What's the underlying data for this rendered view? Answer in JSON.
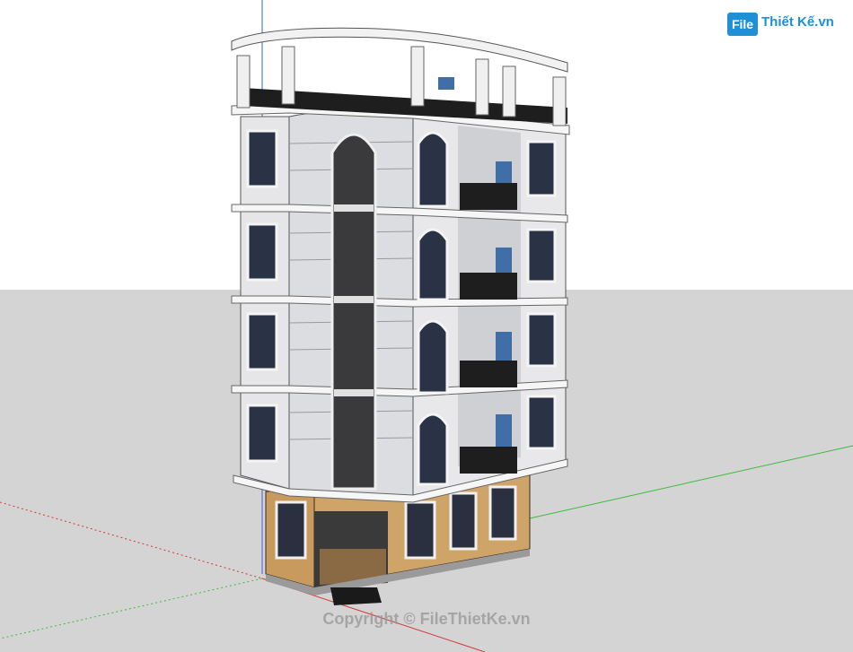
{
  "scene": {
    "description_colors": {
      "sky": "#ffffff",
      "ground": "#d6d6d6",
      "wall": "#e8e8ea",
      "trim": "#f4f4f4",
      "window_glass": "#2f3a4e",
      "railing": "#1e1e1e",
      "ground_floor_stone": "#caa066",
      "axis_green": "#3dbb3d",
      "axis_red": "#d23a3a",
      "axis_blue": "#3a5fd2"
    }
  },
  "logo": {
    "badge": "File",
    "text": "Thiết Kế.vn"
  },
  "watermark": "Copyright © FileThietKe.vn"
}
